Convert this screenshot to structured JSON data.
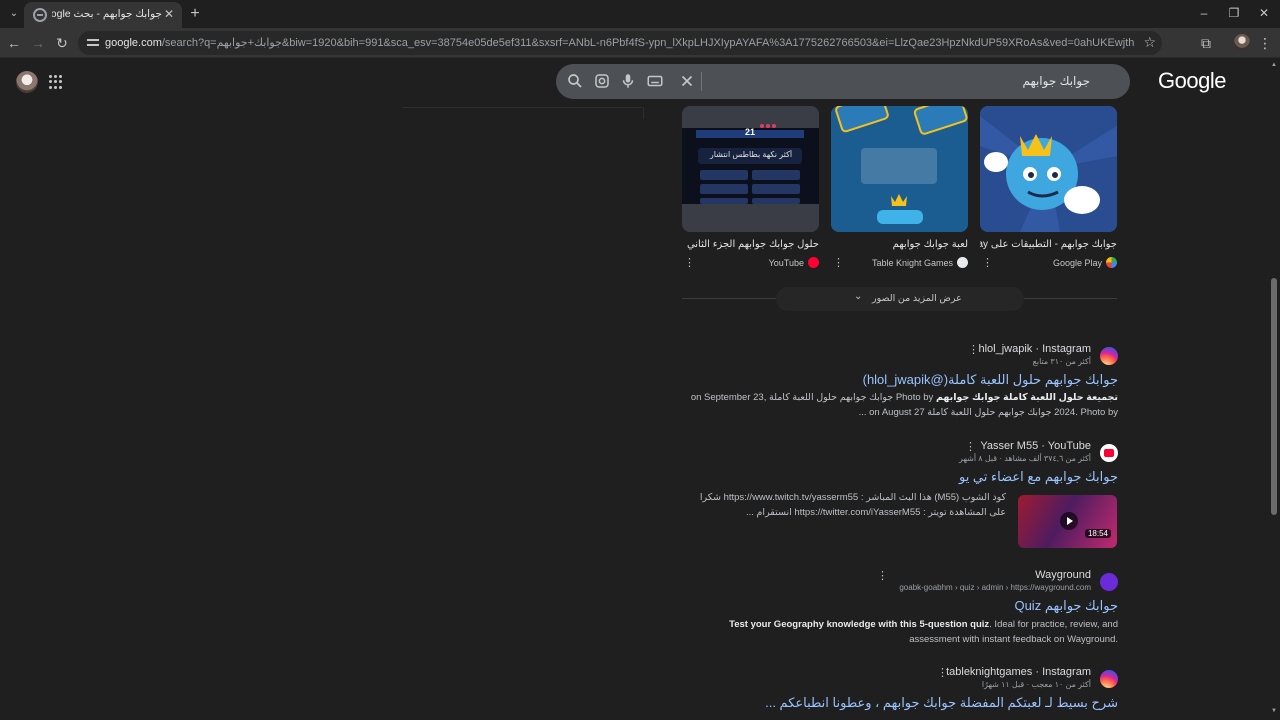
{
  "tab": {
    "title": "جوابك جوابهم - بحث Google"
  },
  "url": {
    "host": "google.com",
    "path": "/search?q=جوابك+جوابهم&biw=1920&bih=991&sca_esv=38754e05de5ef311&sxsrf=ANbL-n6Pbf4fS-ypn_lXkpLHJXIypAYAFA%3A1775262766503&ei=LlzQae23HpzNkdUP59XRoAs&ved=0ahUKEwjthKU-dKTAxWcZqQEHedqFLQQ4dUDCBE&u..."
  },
  "search": {
    "query": "جوابك جوابهم"
  },
  "logo": "Google",
  "images": [
    {
      "caption": "جوابك جوابهم - التطبيقات على Google Play",
      "source": "Google Play"
    },
    {
      "caption": "لعبة جوابك جوابهم",
      "source": "Table Knight Games"
    },
    {
      "caption": "حلول جوابك جوابهم الجزء الثاني",
      "source": "YouTube",
      "text_card": "أكثر نكهة بطاطس انتشار",
      "number": "21"
    }
  ],
  "more_images": "عرض المزيد من الصور",
  "results": [
    {
      "site": "hlol_jwapik · Instagram",
      "meta": "أكثر من ٣١٠ متابع",
      "title": "جوابك جوابهم حلول اللعبة كاملة(@hlol_jwapik)",
      "snippet_bold": "تجميعة حلول اللعبة كاملة جوابك جوابهم",
      "snippet": "Photo by جوابك جوابهم حلول اللعبة كاملة on September 23, 2024. Photo by جوابك جوابهم حلول اللعبة كاملة on August 27 ..."
    },
    {
      "site": "Yasser M55 · YouTube",
      "meta": "أكثر من ٣٧٤,٦ ألف مشاهد · قبل ٨ أشهر",
      "title": "جوابك جوابهم مع اعضاء تي يو",
      "snippet": "كود الشوب (M55) هذا البث المباشر : https://www.twitch.tv/yasserm55 شكرا على المشاهدة تويتر : https://twitter.com/iYasserM55 انستقرام ...",
      "duration": "18:54"
    },
    {
      "site": "Wayground",
      "meta": "goabk-goabhm › quiz › admin › https://wayground.com",
      "title": "جوابك جوابهم Quiz",
      "snippet_bold": "Test your Geography knowledge with this 5-question quiz",
      "snippet": ". Ideal for practice, review, and assessment with instant feedback on Wayground."
    },
    {
      "site": "tableknightgames · Instagram",
      "meta": "أكثر من ١٠ معجب · قبل ١١ شهرًا",
      "title": "شرح بسيط لـ لعبتكم المفضلة جوابك جوابهم ، وعطونا انطباعكم ..."
    }
  ],
  "colors": {
    "background": "#1f1f1f",
    "link": "#99c3ff",
    "searchbox": "#4d5156"
  }
}
